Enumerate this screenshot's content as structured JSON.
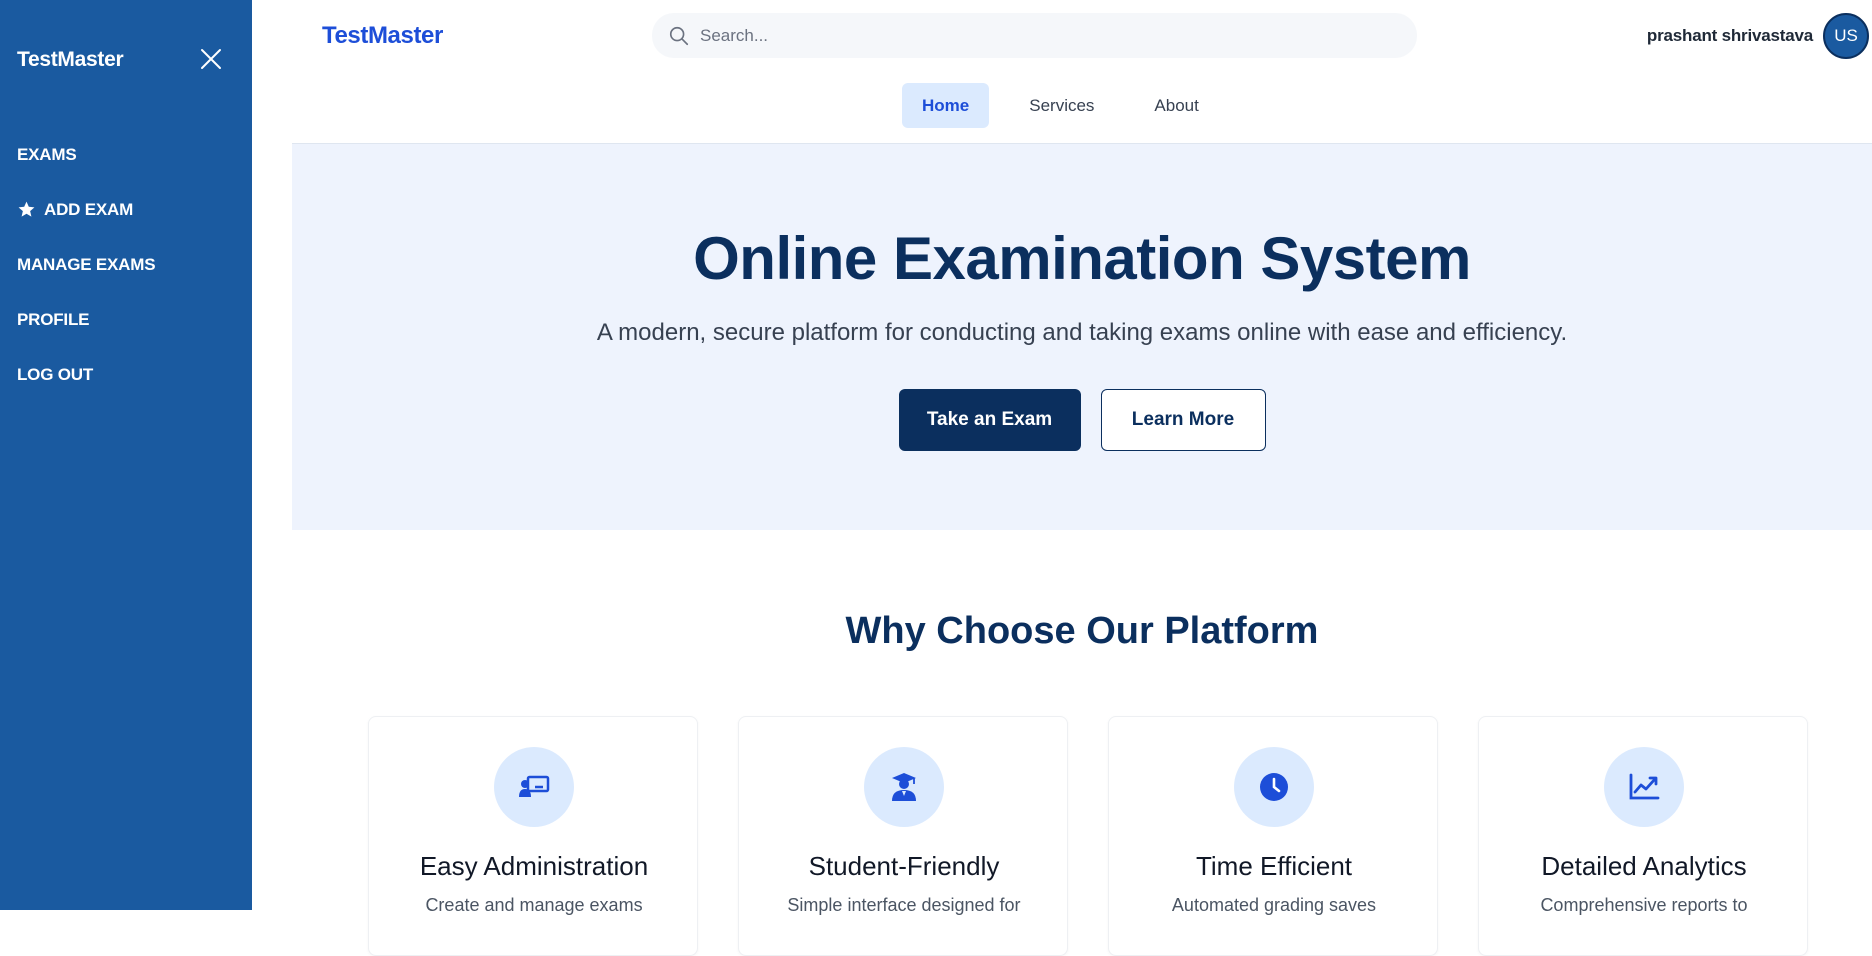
{
  "sidebar": {
    "brand": "TestMaster",
    "items": [
      {
        "label": "EXAMS"
      },
      {
        "label": "ADD EXAM",
        "icon": "star-icon"
      },
      {
        "label": "MANAGE EXAMS"
      },
      {
        "label": "PROFILE"
      },
      {
        "label": "LOG OUT"
      }
    ],
    "bg_color": "#1a5aa0"
  },
  "header": {
    "brand": "TestMaster",
    "search": {
      "placeholder": "Search...",
      "value": ""
    },
    "user": {
      "name": "prashant shrivastava",
      "initials": "US"
    },
    "tabs": [
      {
        "label": "Home",
        "active": true
      },
      {
        "label": "Services",
        "active": false
      },
      {
        "label": "About",
        "active": false
      }
    ]
  },
  "hero": {
    "title": "Online Examination System",
    "subtitle": "A modern, secure platform for conducting and taking exams online with ease and efficiency.",
    "primary_button": "Take an Exam",
    "secondary_button": "Learn More"
  },
  "features": {
    "title": "Why Choose Our Platform",
    "cards": [
      {
        "icon": "chalkboard-teacher-icon",
        "title": "Easy Administration",
        "desc": "Create and manage exams"
      },
      {
        "icon": "graduate-icon",
        "title": "Student-Friendly",
        "desc": "Simple interface designed for"
      },
      {
        "icon": "clock-icon",
        "title": "Time Efficient",
        "desc": "Automated grading saves"
      },
      {
        "icon": "chart-line-icon",
        "title": "Detailed Analytics",
        "desc": "Comprehensive reports to"
      }
    ]
  },
  "colors": {
    "accent": "#1d4ed8",
    "navy": "#0b2f5e",
    "hero_bg": "#eef3fd",
    "icon_bg": "#dbeafe"
  }
}
